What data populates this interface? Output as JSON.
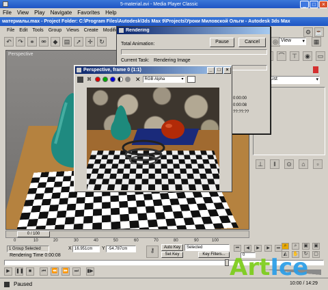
{
  "player": {
    "title": "5-material.avi - Media Player Classic",
    "menu": [
      "File",
      "View",
      "Play",
      "Navigate",
      "Favorites",
      "Help"
    ],
    "status": "Paused",
    "time": "10:00 / 14:29"
  },
  "max": {
    "title": "материалы.max - Project Folder: C:\\Program Files\\Autodesk\\3ds Max 9\\Projects\\Уроки Миловской Ольги - Autodesk 3ds Max",
    "menu": [
      "File",
      "Edit",
      "Tools",
      "Group",
      "Views",
      "Create",
      "Modifiers"
    ],
    "viewport_label": "Perspective",
    "view_dropdown": "View",
    "list_dropdown": "List",
    "frame_counter": "0 / 100",
    "ticks": [
      "0",
      "10",
      "20",
      "30",
      "40",
      "50",
      "60",
      "70",
      "80",
      "90",
      "100"
    ],
    "group_selected": "1 Group Selected",
    "x_label": "X",
    "x_value": "16.951cm",
    "y_label": "Y",
    "y_value": "-54.787cm",
    "rendering_time": "Rendering Time  0:00:08",
    "auto_key": "Auto Key",
    "set_key": "Set Key",
    "selected": "Selected",
    "key_filters": "Key Filters...",
    "frame_input": "0"
  },
  "render_dialog": {
    "title": "Rendering",
    "pause": "Pause",
    "cancel": "Cancel",
    "total_animation": "Total Animation:",
    "current_task_label": "Current Task:",
    "current_task_value": "Rendering Image",
    "right_values": [
      "0:00:00",
      "0:00:08",
      "??:??:??"
    ]
  },
  "frame_window": {
    "title": "Perspective, frame 0 (1:1)",
    "channel": "RGB Alpha"
  },
  "watermark": {
    "text_a": "Art",
    "text_b": "Ice"
  }
}
